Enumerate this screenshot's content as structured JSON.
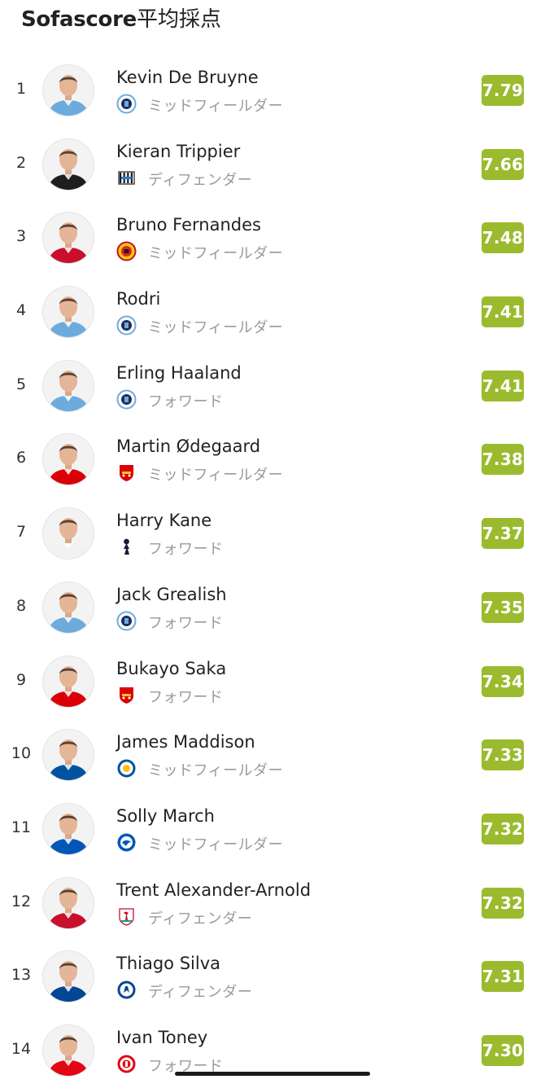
{
  "header": {
    "title_brand": "Sofascore",
    "title_suffix": "平均採点"
  },
  "players": [
    {
      "rank": "1",
      "name": "Kevin De Bruyne",
      "team": "Manchester City",
      "team_icon": "mancity-crest-icon",
      "position": "ミッドフィールダー",
      "rating": "7.79",
      "kit": "#6cabdd"
    },
    {
      "rank": "2",
      "name": "Kieran Trippier",
      "team": "Newcastle United",
      "team_icon": "newcastle-crest-icon",
      "position": "ディフェンダー",
      "rating": "7.66",
      "kit": "#1e1e1e"
    },
    {
      "rank": "3",
      "name": "Bruno Fernandes",
      "team": "Manchester United",
      "team_icon": "manutd-crest-icon",
      "position": "ミッドフィールダー",
      "rating": "7.48",
      "kit": "#c8102e"
    },
    {
      "rank": "4",
      "name": "Rodri",
      "team": "Manchester City",
      "team_icon": "mancity-crest-icon",
      "position": "ミッドフィールダー",
      "rating": "7.41",
      "kit": "#6cabdd"
    },
    {
      "rank": "5",
      "name": "Erling Haaland",
      "team": "Manchester City",
      "team_icon": "mancity-crest-icon",
      "position": "フォワード",
      "rating": "7.41",
      "kit": "#6cabdd"
    },
    {
      "rank": "6",
      "name": "Martin Ødegaard",
      "team": "Arsenal",
      "team_icon": "arsenal-crest-icon",
      "position": "ミッドフィールダー",
      "rating": "7.38",
      "kit": "#db0007"
    },
    {
      "rank": "7",
      "name": "Harry Kane",
      "team": "Tottenham Hotspur",
      "team_icon": "tottenham-crest-icon",
      "position": "フォワード",
      "rating": "7.37",
      "kit": "#f2f2f2"
    },
    {
      "rank": "8",
      "name": "Jack Grealish",
      "team": "Manchester City",
      "team_icon": "mancity-crest-icon",
      "position": "フォワード",
      "rating": "7.35",
      "kit": "#6cabdd"
    },
    {
      "rank": "9",
      "name": "Bukayo Saka",
      "team": "Arsenal",
      "team_icon": "arsenal-crest-icon",
      "position": "フォワード",
      "rating": "7.34",
      "kit": "#db0007"
    },
    {
      "rank": "10",
      "name": "James Maddison",
      "team": "Leicester City",
      "team_icon": "leicester-crest-icon",
      "position": "ミッドフィールダー",
      "rating": "7.33",
      "kit": "#0053a0"
    },
    {
      "rank": "11",
      "name": "Solly March",
      "team": "Brighton",
      "team_icon": "brighton-crest-icon",
      "position": "ミッドフィールダー",
      "rating": "7.32",
      "kit": "#0057b8"
    },
    {
      "rank": "12",
      "name": "Trent Alexander-Arnold",
      "team": "Liverpool",
      "team_icon": "liverpool-crest-icon",
      "position": "ディフェンダー",
      "rating": "7.32",
      "kit": "#c8102e"
    },
    {
      "rank": "13",
      "name": "Thiago Silva",
      "team": "Chelsea",
      "team_icon": "chelsea-crest-icon",
      "position": "ディフェンダー",
      "rating": "7.31",
      "kit": "#034694"
    },
    {
      "rank": "14",
      "name": "Ivan Toney",
      "team": "Brentford",
      "team_icon": "brentford-crest-icon",
      "position": "フォワード",
      "rating": "7.30",
      "kit": "#e30613"
    }
  ],
  "colors": {
    "rating_badge": "#9bbb2e",
    "text_primary": "#222222",
    "text_secondary": "#9a9a9a"
  }
}
